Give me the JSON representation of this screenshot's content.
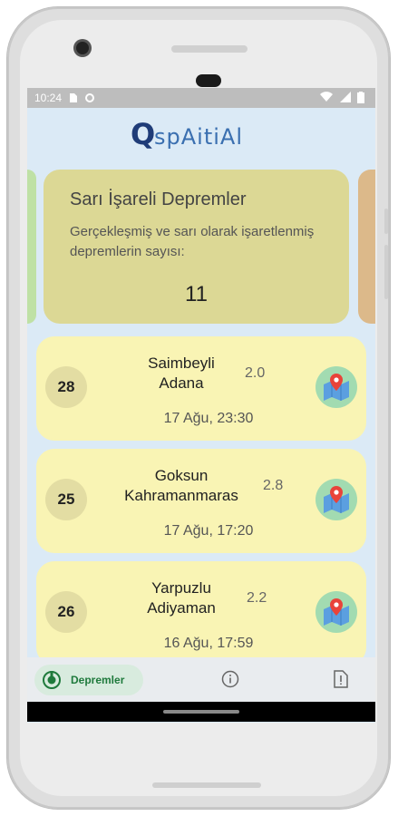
{
  "status_bar": {
    "time": "10:24"
  },
  "app": {
    "logo_letter": "Q",
    "logo_text": "spAitiAl"
  },
  "summary_card": {
    "title": "Sarı İşareli Depremler",
    "description": "Gerçekleşmiş ve sarı olarak işaretlenmiş depremlerin sayısı:",
    "count": "11"
  },
  "earthquakes": [
    {
      "magnitude_badge": "28",
      "district": "Saimbeyli",
      "city": "Adana",
      "value": "2.0",
      "date": "17 Ağu, 23:30"
    },
    {
      "magnitude_badge": "25",
      "district": "Goksun",
      "city": "Kahramanmaras",
      "value": "2.8",
      "date": "17 Ağu, 17:20"
    },
    {
      "magnitude_badge": "26",
      "district": "Yarpuzlu",
      "city": "Adiyaman",
      "value": "2.2",
      "date": "16 Ağu, 17:59"
    }
  ],
  "bottom_nav": {
    "active_label": "Depremler",
    "items": [
      "earthquake-icon",
      "info-icon",
      "alert-icon"
    ]
  },
  "colors": {
    "screen_bg": "#dbeaf6",
    "summary_card": "#dcd895",
    "quake_card": "#f9f4b4",
    "map_button": "#a2dbb1",
    "nav_active": "#d8ebde",
    "accent_green": "#1f7a3c"
  }
}
